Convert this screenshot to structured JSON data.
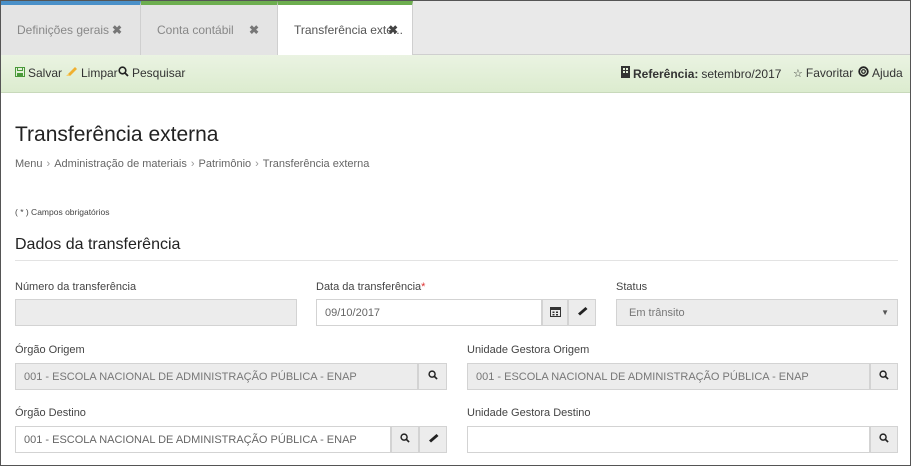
{
  "tabs": [
    {
      "label": "Definições gerais",
      "close": "✖"
    },
    {
      "label": "Conta contábil",
      "close": "✖"
    },
    {
      "label": "Transferência exte...",
      "close": "✖"
    }
  ],
  "toolbar": {
    "save_label": "Salvar",
    "clear_label": "Limpar",
    "search_label": "Pesquisar",
    "reference_label": "Referência:",
    "reference_value": "setembro/2017",
    "favorite_label": "Favoritar",
    "help_label": "Ajuda"
  },
  "page": {
    "title": "Transferência externa",
    "breadcrumb": [
      "Menu",
      "Administração de materiais",
      "Patrimônio",
      "Transferência externa"
    ],
    "breadcrumb_sep": "›",
    "required_note": "( * ) Campos obrigatórios",
    "section_title": "Dados da transferência"
  },
  "form": {
    "numero": {
      "label": "Número da transferência",
      "value": ""
    },
    "data": {
      "label": "Data da transferência",
      "required_mark": "*",
      "value": "09/10/2017"
    },
    "status": {
      "label": "Status",
      "value": "Em trânsito"
    },
    "orgao_origem": {
      "label": "Órgão Origem",
      "value": "001 - ESCOLA NACIONAL DE ADMINISTRAÇÃO PÚBLICA - ENAP"
    },
    "ug_origem": {
      "label": "Unidade Gestora Origem",
      "value": "001 - ESCOLA NACIONAL DE ADMINISTRAÇÃO PÚBLICA - ENAP"
    },
    "orgao_destino": {
      "label": "Órgão Destino",
      "value": "001 - ESCOLA NACIONAL DE ADMINISTRAÇÃO PÚBLICA - ENAP"
    },
    "ug_destino": {
      "label": "Unidade Gestora Destino",
      "value": ""
    }
  },
  "icons": {
    "save": "floppy-icon",
    "clear": "eraser-icon",
    "search": "magnifier-icon",
    "reference": "building-icon",
    "favorite": "star-outline-icon",
    "help": "lifebuoy-icon",
    "calendar": "calendar-icon",
    "dropdown": "caret-down-icon"
  },
  "colors": {
    "accent_green": "#6dae4f",
    "accent_blue": "#4a90c8",
    "required_red": "#d33333",
    "toolbar_bg": "#e3f0d8"
  }
}
